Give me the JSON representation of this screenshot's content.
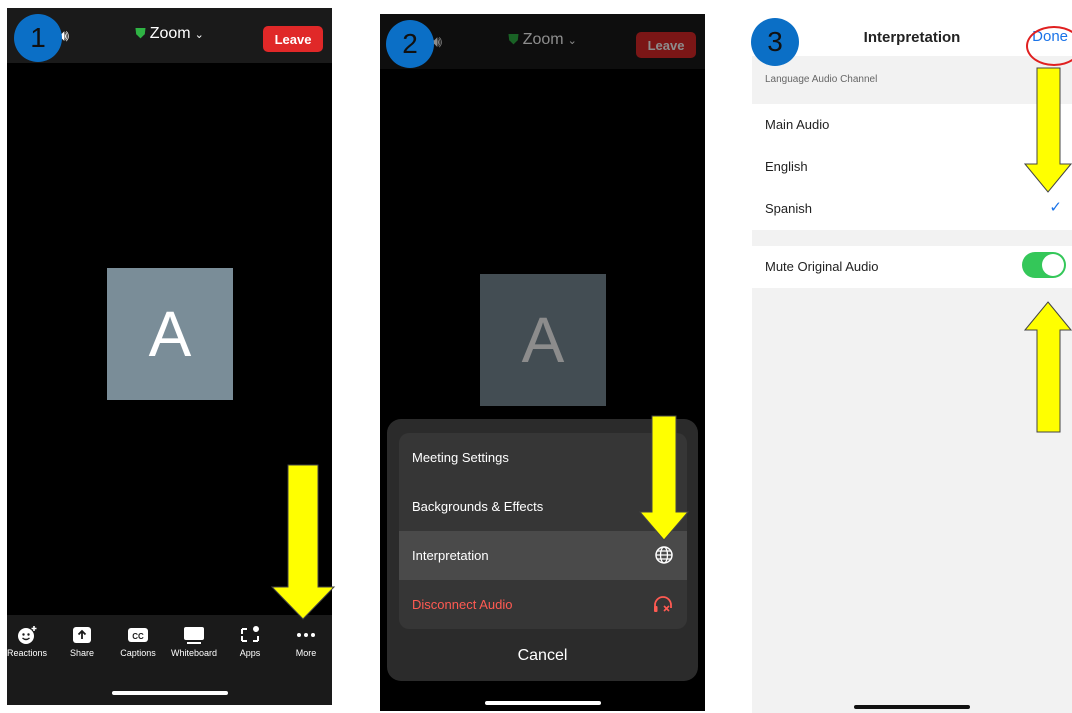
{
  "colors": {
    "arrow": "#ffff00",
    "badge": "#0b6fc6",
    "leave": "#e02828",
    "toggle_on": "#34c759",
    "accent": "#1a73e8",
    "danger": "#ff5a52"
  },
  "step1": {
    "badge": "1",
    "title": "Zoom",
    "leave_label": "Leave",
    "avatar_letter": "A",
    "toolbar": [
      {
        "label": "Reactions",
        "icon": "reactions-icon"
      },
      {
        "label": "Share",
        "icon": "share-icon"
      },
      {
        "label": "Captions",
        "icon": "captions-icon"
      },
      {
        "label": "Whiteboard",
        "icon": "whiteboard-icon"
      },
      {
        "label": "Apps",
        "icon": "apps-icon"
      },
      {
        "label": "More",
        "icon": "more-icon"
      }
    ]
  },
  "step2": {
    "badge": "2",
    "title": "Zoom",
    "leave_label": "Leave",
    "avatar_letter": "A",
    "menu": [
      {
        "label": "Meeting Settings"
      },
      {
        "label": "Backgrounds & Effects"
      },
      {
        "label": "Interpretation",
        "icon": "globe-icon"
      },
      {
        "label": "Disconnect Audio",
        "icon": "headphones-disconnect-icon"
      }
    ],
    "cancel_label": "Cancel"
  },
  "step3": {
    "badge": "3",
    "title": "Interpretation",
    "done_label": "Done",
    "section_header": "Language Audio Channel",
    "options": [
      {
        "label": "Main Audio"
      },
      {
        "label": "English"
      },
      {
        "label": "Spanish",
        "selected": true
      }
    ],
    "mute_label": "Mute Original Audio",
    "mute_on": true
  }
}
